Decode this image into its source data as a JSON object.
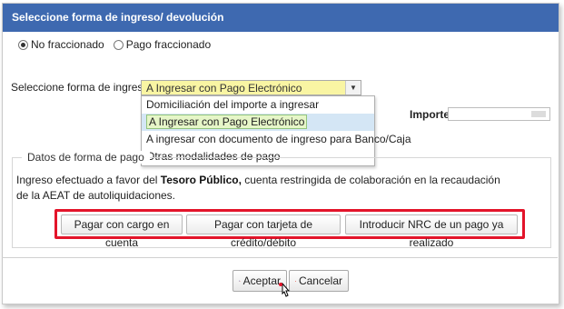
{
  "dialog": {
    "title": "Seleccione forma de ingreso/ devolución"
  },
  "payment_mode": {
    "options": [
      {
        "label": "No fraccionado",
        "selected": true
      },
      {
        "label": "Pago fraccionado",
        "selected": false
      }
    ]
  },
  "forma_ingreso": {
    "label": "Seleccione forma de ingreso:",
    "selected_value": "A Ingresar con Pago Electrónico",
    "options": [
      "Domiciliación del importe a ingresar",
      "A Ingresar con Pago Electrónico",
      "A ingresar con documento de ingreso para Banco/Caja",
      "Otras modalidades de pago"
    ],
    "highlighted_index": 1
  },
  "importe": {
    "label": "Importe",
    "value": ""
  },
  "datos": {
    "legend": "Datos de forma de pago",
    "text_before": "Ingreso efectuado a favor del ",
    "text_bold": "Tesoro Público,",
    "text_after": " cuenta restringida de colaboración en la recaudación de la AEAT de autoliquidaciones."
  },
  "payment_buttons": {
    "cargo_cuenta": "Pagar con cargo en cuenta",
    "tarjeta": "Pagar con tarjeta de crédito/débito",
    "nrc": "Introducir NRC de un pago ya realizado"
  },
  "footer": {
    "accept": "Aceptar",
    "cancel": "Cancelar"
  },
  "colors": {
    "titlebar": "#3e69b0",
    "select_bg": "#f9f5a3",
    "highlight_box": "#e3142a"
  }
}
